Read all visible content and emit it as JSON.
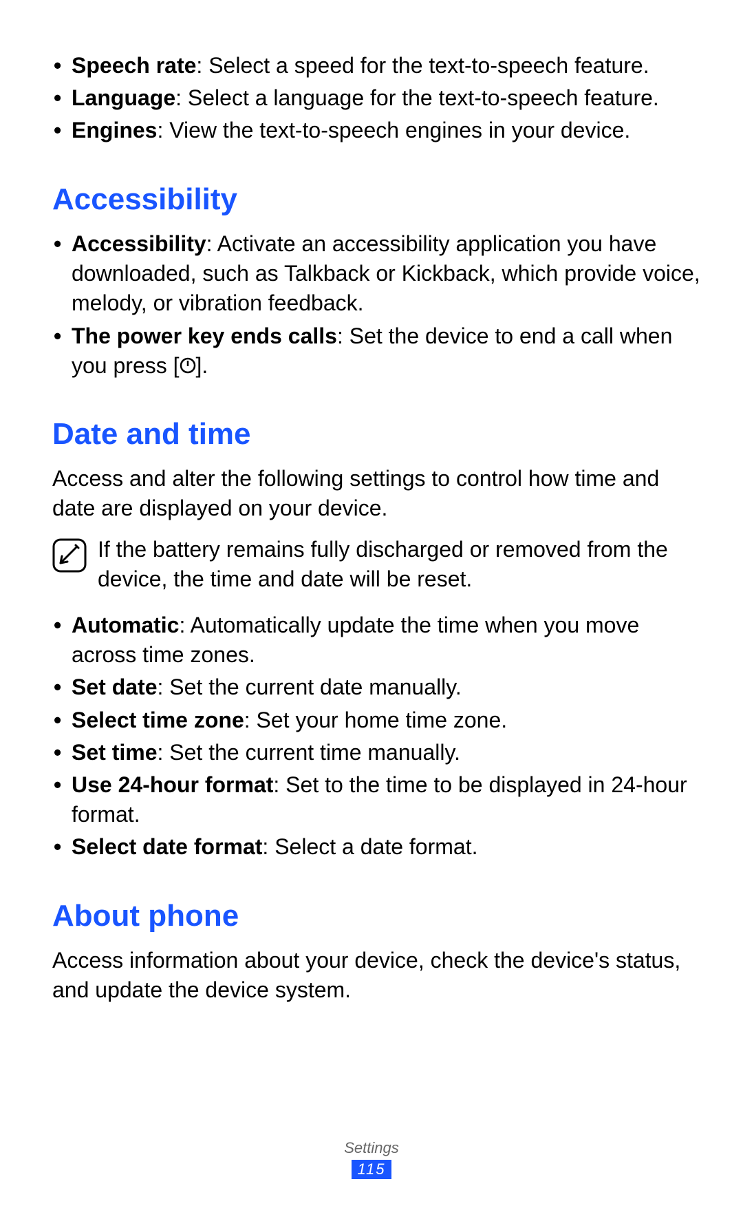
{
  "colors": {
    "accent": "#1955ff"
  },
  "tts": {
    "items": [
      {
        "label": "Speech rate",
        "desc": ": Select a speed for the text-to-speech feature."
      },
      {
        "label": "Language",
        "desc": ": Select a language for the text-to-speech feature."
      },
      {
        "label": "Engines",
        "desc": ": View the text-to-speech engines in your device."
      }
    ]
  },
  "accessibility": {
    "heading": "Accessibility",
    "items": [
      {
        "label": "Accessibility",
        "desc": ": Activate an accessibility application you have downloaded, such as Talkback or Kickback, which provide voice, melody, or vibration feedback."
      },
      {
        "label": "The power key ends calls",
        "desc_pre": ": Set the device to end a call when you press [",
        "desc_post": "]."
      }
    ]
  },
  "datetime": {
    "heading": "Date and time",
    "intro": "Access and alter the following settings to control how time and date are displayed on your device.",
    "note": "If the battery remains fully discharged or removed from the device, the time and date will be reset.",
    "items": [
      {
        "label": "Automatic",
        "desc": ": Automatically update the time when you move across time zones."
      },
      {
        "label": "Set date",
        "desc": ": Set the current date manually."
      },
      {
        "label": "Select time zone",
        "desc": ": Set your home time zone."
      },
      {
        "label": "Set time",
        "desc": ": Set the current time manually."
      },
      {
        "label": "Use 24-hour format",
        "desc": ": Set to the time to be displayed in 24-hour format."
      },
      {
        "label": "Select date format",
        "desc": ": Select a date format."
      }
    ]
  },
  "about": {
    "heading": "About phone",
    "intro": "Access information about your device, check the device's status, and update the device system."
  },
  "footer": {
    "section": "Settings",
    "page": "115"
  }
}
